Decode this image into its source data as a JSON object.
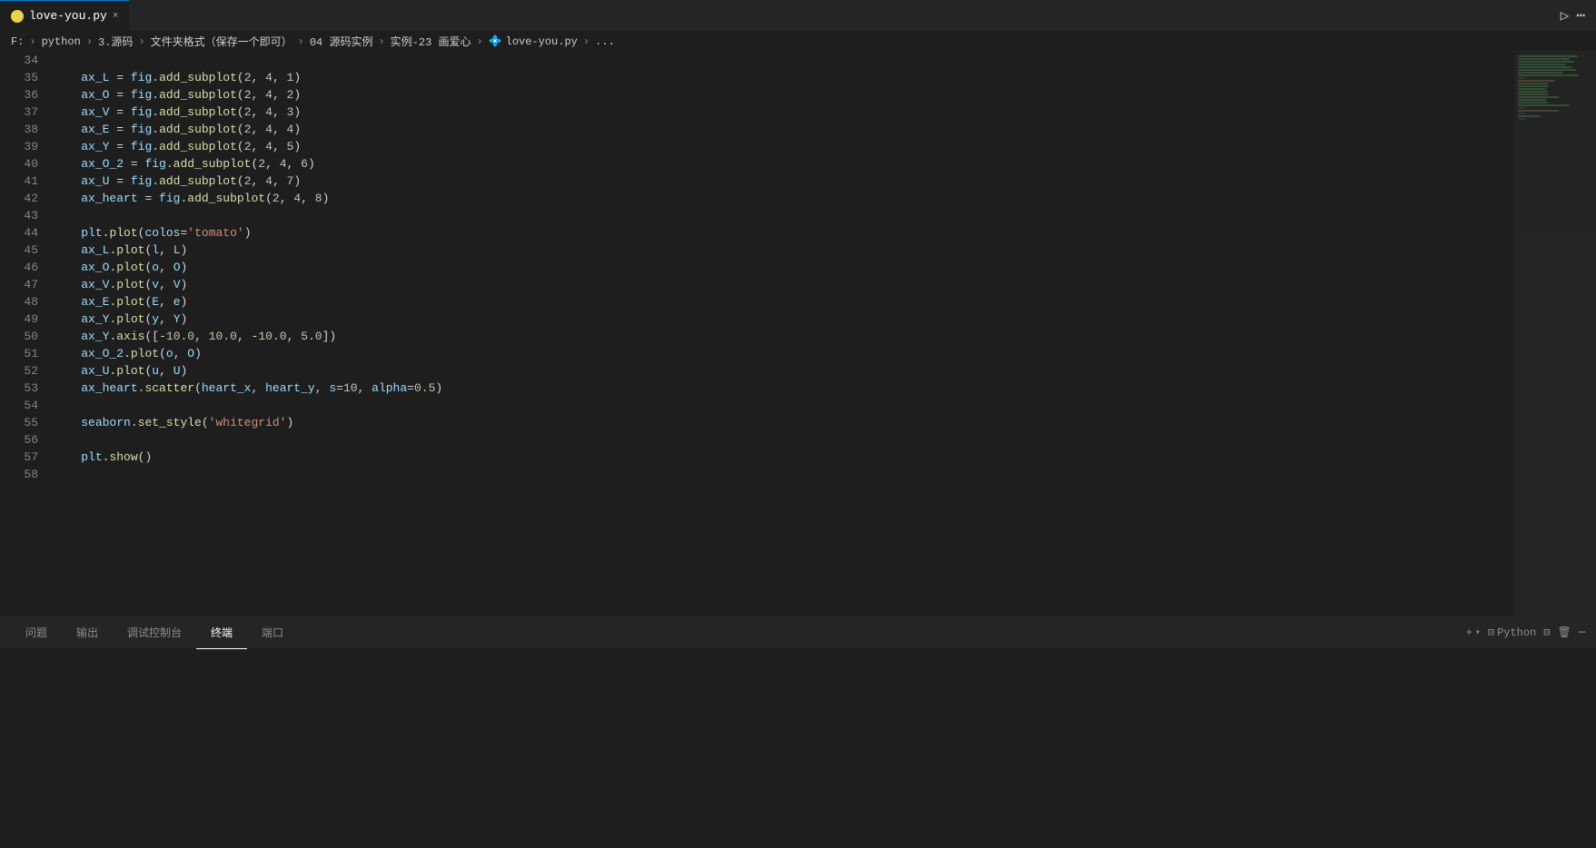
{
  "titleBar": {
    "tab": {
      "label": "love-you.py",
      "closeIcon": "×"
    },
    "runIcon": "▷",
    "moreIcon": "⋯"
  },
  "breadcrumb": {
    "parts": [
      {
        "text": "F:"
      },
      {
        "text": ">"
      },
      {
        "text": "python"
      },
      {
        "text": ">"
      },
      {
        "text": "3.源码"
      },
      {
        "text": ">"
      },
      {
        "text": "文件夹格式（保存一个即可）"
      },
      {
        "text": ">"
      },
      {
        "text": "04 源码实例"
      },
      {
        "text": ">"
      },
      {
        "text": "实例-23 画爱心"
      },
      {
        "text": ">"
      },
      {
        "text": "💠 love-you.py"
      },
      {
        "text": ">"
      },
      {
        "text": "..."
      }
    ]
  },
  "code": {
    "lines": [
      {
        "num": 34,
        "content": ""
      },
      {
        "num": 35,
        "tokens": [
          {
            "t": "var",
            "v": "ax_L"
          },
          {
            "t": "op",
            "v": " = "
          },
          {
            "t": "var",
            "v": "fig"
          },
          {
            "t": "punct",
            "v": "."
          },
          {
            "t": "fn",
            "v": "add_subplot"
          },
          {
            "t": "punct",
            "v": "("
          },
          {
            "t": "num",
            "v": "2"
          },
          {
            "t": "punct",
            "v": ", "
          },
          {
            "t": "num",
            "v": "4"
          },
          {
            "t": "punct",
            "v": ", "
          },
          {
            "t": "num",
            "v": "1"
          },
          {
            "t": "punct",
            "v": ")"
          }
        ]
      },
      {
        "num": 36,
        "tokens": [
          {
            "t": "var",
            "v": "ax_O"
          },
          {
            "t": "op",
            "v": " = "
          },
          {
            "t": "var",
            "v": "fig"
          },
          {
            "t": "punct",
            "v": "."
          },
          {
            "t": "fn",
            "v": "add_subplot"
          },
          {
            "t": "punct",
            "v": "("
          },
          {
            "t": "num",
            "v": "2"
          },
          {
            "t": "punct",
            "v": ", "
          },
          {
            "t": "num",
            "v": "4"
          },
          {
            "t": "punct",
            "v": ", "
          },
          {
            "t": "num",
            "v": "2"
          },
          {
            "t": "punct",
            "v": ")"
          }
        ]
      },
      {
        "num": 37,
        "tokens": [
          {
            "t": "var",
            "v": "ax_V"
          },
          {
            "t": "op",
            "v": " = "
          },
          {
            "t": "var",
            "v": "fig"
          },
          {
            "t": "punct",
            "v": "."
          },
          {
            "t": "fn",
            "v": "add_subplot"
          },
          {
            "t": "punct",
            "v": "("
          },
          {
            "t": "num",
            "v": "2"
          },
          {
            "t": "punct",
            "v": ", "
          },
          {
            "t": "num",
            "v": "4"
          },
          {
            "t": "punct",
            "v": ", "
          },
          {
            "t": "num",
            "v": "3"
          },
          {
            "t": "punct",
            "v": ")"
          }
        ]
      },
      {
        "num": 38,
        "tokens": [
          {
            "t": "var",
            "v": "ax_E"
          },
          {
            "t": "op",
            "v": " = "
          },
          {
            "t": "var",
            "v": "fig"
          },
          {
            "t": "punct",
            "v": "."
          },
          {
            "t": "fn",
            "v": "add_subplot"
          },
          {
            "t": "punct",
            "v": "("
          },
          {
            "t": "num",
            "v": "2"
          },
          {
            "t": "punct",
            "v": ", "
          },
          {
            "t": "num",
            "v": "4"
          },
          {
            "t": "punct",
            "v": ", "
          },
          {
            "t": "num",
            "v": "4"
          },
          {
            "t": "punct",
            "v": ")"
          }
        ]
      },
      {
        "num": 39,
        "tokens": [
          {
            "t": "var",
            "v": "ax_Y"
          },
          {
            "t": "op",
            "v": " = "
          },
          {
            "t": "var",
            "v": "fig"
          },
          {
            "t": "punct",
            "v": "."
          },
          {
            "t": "fn",
            "v": "add_subplot"
          },
          {
            "t": "punct",
            "v": "("
          },
          {
            "t": "num",
            "v": "2"
          },
          {
            "t": "punct",
            "v": ", "
          },
          {
            "t": "num",
            "v": "4"
          },
          {
            "t": "punct",
            "v": ", "
          },
          {
            "t": "num",
            "v": "5"
          },
          {
            "t": "punct",
            "v": ")"
          }
        ]
      },
      {
        "num": 40,
        "tokens": [
          {
            "t": "var",
            "v": "ax_O_2"
          },
          {
            "t": "op",
            "v": " = "
          },
          {
            "t": "var",
            "v": "fig"
          },
          {
            "t": "punct",
            "v": "."
          },
          {
            "t": "fn",
            "v": "add_subplot"
          },
          {
            "t": "punct",
            "v": "("
          },
          {
            "t": "num",
            "v": "2"
          },
          {
            "t": "punct",
            "v": ", "
          },
          {
            "t": "num",
            "v": "4"
          },
          {
            "t": "punct",
            "v": ", "
          },
          {
            "t": "num",
            "v": "6"
          },
          {
            "t": "punct",
            "v": ")"
          }
        ]
      },
      {
        "num": 41,
        "tokens": [
          {
            "t": "var",
            "v": "ax_U"
          },
          {
            "t": "op",
            "v": " = "
          },
          {
            "t": "var",
            "v": "fig"
          },
          {
            "t": "punct",
            "v": "."
          },
          {
            "t": "fn",
            "v": "add_subplot"
          },
          {
            "t": "punct",
            "v": "("
          },
          {
            "t": "num",
            "v": "2"
          },
          {
            "t": "punct",
            "v": ", "
          },
          {
            "t": "num",
            "v": "4"
          },
          {
            "t": "punct",
            "v": ", "
          },
          {
            "t": "num",
            "v": "7"
          },
          {
            "t": "punct",
            "v": ")"
          }
        ]
      },
      {
        "num": 42,
        "tokens": [
          {
            "t": "var",
            "v": "ax_heart"
          },
          {
            "t": "op",
            "v": " = "
          },
          {
            "t": "var",
            "v": "fig"
          },
          {
            "t": "punct",
            "v": "."
          },
          {
            "t": "fn",
            "v": "add_subplot"
          },
          {
            "t": "punct",
            "v": "("
          },
          {
            "t": "num",
            "v": "2"
          },
          {
            "t": "punct",
            "v": ", "
          },
          {
            "t": "num",
            "v": "4"
          },
          {
            "t": "punct",
            "v": ", "
          },
          {
            "t": "num",
            "v": "8"
          },
          {
            "t": "punct",
            "v": ")"
          }
        ]
      },
      {
        "num": 43,
        "content": ""
      },
      {
        "num": 44,
        "tokens": [
          {
            "t": "var",
            "v": "plt"
          },
          {
            "t": "punct",
            "v": "."
          },
          {
            "t": "fn",
            "v": "plot"
          },
          {
            "t": "punct",
            "v": "("
          },
          {
            "t": "param-name",
            "v": "colos"
          },
          {
            "t": "op",
            "v": "="
          },
          {
            "t": "str",
            "v": "'tomato'"
          },
          {
            "t": "punct",
            "v": ")"
          }
        ]
      },
      {
        "num": 45,
        "tokens": [
          {
            "t": "var",
            "v": "ax_L"
          },
          {
            "t": "punct",
            "v": "."
          },
          {
            "t": "fn",
            "v": "plot"
          },
          {
            "t": "punct",
            "v": "("
          },
          {
            "t": "var",
            "v": "l"
          },
          {
            "t": "punct",
            "v": ", "
          },
          {
            "t": "var",
            "v": "L"
          },
          {
            "t": "punct",
            "v": ")"
          }
        ]
      },
      {
        "num": 46,
        "tokens": [
          {
            "t": "var",
            "v": "ax_O"
          },
          {
            "t": "punct",
            "v": "."
          },
          {
            "t": "fn",
            "v": "plot"
          },
          {
            "t": "punct",
            "v": "("
          },
          {
            "t": "var",
            "v": "o"
          },
          {
            "t": "punct",
            "v": ", "
          },
          {
            "t": "var",
            "v": "O"
          },
          {
            "t": "punct",
            "v": ")"
          }
        ]
      },
      {
        "num": 47,
        "tokens": [
          {
            "t": "var",
            "v": "ax_V"
          },
          {
            "t": "punct",
            "v": "."
          },
          {
            "t": "fn",
            "v": "plot"
          },
          {
            "t": "punct",
            "v": "("
          },
          {
            "t": "var",
            "v": "v"
          },
          {
            "t": "punct",
            "v": ", "
          },
          {
            "t": "var",
            "v": "V"
          },
          {
            "t": "punct",
            "v": ")"
          }
        ]
      },
      {
        "num": 48,
        "tokens": [
          {
            "t": "var",
            "v": "ax_E"
          },
          {
            "t": "punct",
            "v": "."
          },
          {
            "t": "fn",
            "v": "plot"
          },
          {
            "t": "punct",
            "v": "("
          },
          {
            "t": "var",
            "v": "E"
          },
          {
            "t": "punct",
            "v": ", "
          },
          {
            "t": "var",
            "v": "e"
          },
          {
            "t": "punct",
            "v": ")"
          }
        ]
      },
      {
        "num": 49,
        "tokens": [
          {
            "t": "var",
            "v": "ax_Y"
          },
          {
            "t": "punct",
            "v": "."
          },
          {
            "t": "fn",
            "v": "plot"
          },
          {
            "t": "punct",
            "v": "("
          },
          {
            "t": "var",
            "v": "y"
          },
          {
            "t": "punct",
            "v": ", "
          },
          {
            "t": "var",
            "v": "Y"
          },
          {
            "t": "punct",
            "v": ")"
          }
        ]
      },
      {
        "num": 50,
        "tokens": [
          {
            "t": "var",
            "v": "ax_Y"
          },
          {
            "t": "punct",
            "v": "."
          },
          {
            "t": "fn",
            "v": "axis"
          },
          {
            "t": "punct",
            "v": "(["
          },
          {
            "t": "op",
            "v": "-"
          },
          {
            "t": "num",
            "v": "10.0"
          },
          {
            "t": "punct",
            "v": ", "
          },
          {
            "t": "num",
            "v": "10.0"
          },
          {
            "t": "punct",
            "v": ", "
          },
          {
            "t": "op",
            "v": "-"
          },
          {
            "t": "num",
            "v": "10.0"
          },
          {
            "t": "punct",
            "v": ", "
          },
          {
            "t": "num",
            "v": "5.0"
          },
          {
            "t": "punct",
            "v": "])"
          }
        ]
      },
      {
        "num": 51,
        "tokens": [
          {
            "t": "var",
            "v": "ax_O_2"
          },
          {
            "t": "punct",
            "v": "."
          },
          {
            "t": "fn",
            "v": "plot"
          },
          {
            "t": "punct",
            "v": "("
          },
          {
            "t": "var",
            "v": "o"
          },
          {
            "t": "punct",
            "v": ", "
          },
          {
            "t": "var",
            "v": "O"
          },
          {
            "t": "punct",
            "v": ")"
          }
        ]
      },
      {
        "num": 52,
        "tokens": [
          {
            "t": "var",
            "v": "ax_U"
          },
          {
            "t": "punct",
            "v": "."
          },
          {
            "t": "fn",
            "v": "plot"
          },
          {
            "t": "punct",
            "v": "("
          },
          {
            "t": "var",
            "v": "u"
          },
          {
            "t": "punct",
            "v": ", "
          },
          {
            "t": "var",
            "v": "U"
          },
          {
            "t": "punct",
            "v": ")"
          }
        ]
      },
      {
        "num": 53,
        "tokens": [
          {
            "t": "var",
            "v": "ax_heart"
          },
          {
            "t": "punct",
            "v": "."
          },
          {
            "t": "fn",
            "v": "scatter"
          },
          {
            "t": "punct",
            "v": "("
          },
          {
            "t": "var",
            "v": "heart_x"
          },
          {
            "t": "punct",
            "v": ", "
          },
          {
            "t": "var",
            "v": "heart_y"
          },
          {
            "t": "punct",
            "v": ", "
          },
          {
            "t": "param-name",
            "v": "s"
          },
          {
            "t": "op",
            "v": "="
          },
          {
            "t": "num",
            "v": "10"
          },
          {
            "t": "punct",
            "v": ", "
          },
          {
            "t": "param-name",
            "v": "alpha"
          },
          {
            "t": "op",
            "v": "="
          },
          {
            "t": "num",
            "v": "0.5"
          },
          {
            "t": "punct",
            "v": ")"
          }
        ]
      },
      {
        "num": 54,
        "content": ""
      },
      {
        "num": 55,
        "tokens": [
          {
            "t": "var",
            "v": "seaborn"
          },
          {
            "t": "punct",
            "v": "."
          },
          {
            "t": "fn",
            "v": "set_style"
          },
          {
            "t": "punct",
            "v": "("
          },
          {
            "t": "str",
            "v": "'whitegrid'"
          },
          {
            "t": "punct",
            "v": ")"
          }
        ]
      },
      {
        "num": 56,
        "content": ""
      },
      {
        "num": 57,
        "tokens": [
          {
            "t": "var",
            "v": "plt"
          },
          {
            "t": "punct",
            "v": "."
          },
          {
            "t": "fn",
            "v": "show"
          },
          {
            "t": "punct",
            "v": "()"
          }
        ]
      },
      {
        "num": 58,
        "content": ""
      }
    ]
  },
  "panel": {
    "tabs": [
      {
        "label": "问题",
        "active": false
      },
      {
        "label": "输出",
        "active": false
      },
      {
        "label": "调试控制台",
        "active": false
      },
      {
        "label": "终端",
        "active": true
      },
      {
        "label": "端口",
        "active": false
      }
    ],
    "actions": {
      "add": "+",
      "split": "⊡",
      "trash": "🗑",
      "more": "⋯",
      "terminal_label": "⊡ Python"
    }
  }
}
